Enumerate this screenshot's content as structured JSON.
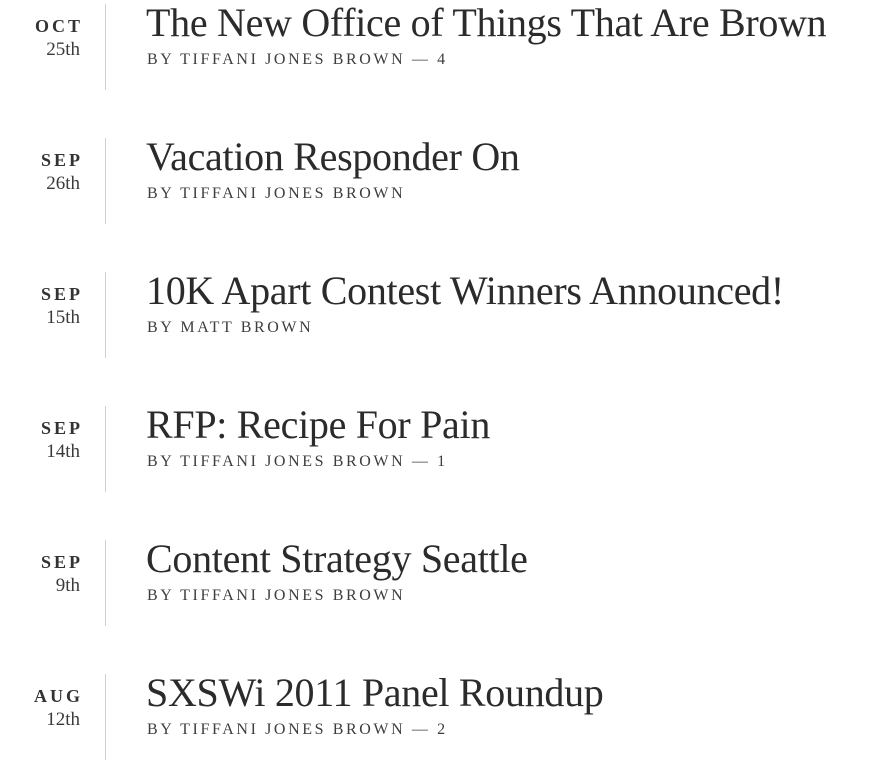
{
  "posts": [
    {
      "month": "OCT",
      "day": "25th",
      "title": "The New Office of Things That Are Brown",
      "byline": "BY TIFFANI JONES BROWN",
      "comments": "— 4"
    },
    {
      "month": "SEP",
      "day": "26th",
      "title": "Vacation Responder On",
      "byline": "BY TIFFANI JONES BROWN",
      "comments": ""
    },
    {
      "month": "SEP",
      "day": "15th",
      "title": "10K Apart Contest Winners Announced!",
      "byline": "BY MATT BROWN",
      "comments": ""
    },
    {
      "month": "SEP",
      "day": "14th",
      "title": "RFP: Recipe For Pain",
      "byline": "BY TIFFANI JONES BROWN",
      "comments": "— 1"
    },
    {
      "month": "SEP",
      "day": "9th",
      "title": "Content Strategy Seattle",
      "byline": "BY TIFFANI JONES BROWN",
      "comments": ""
    },
    {
      "month": "AUG",
      "day": "12th",
      "title": "SXSWi 2011 Panel Roundup",
      "byline": "BY TIFFANI JONES BROWN",
      "comments": "— 2"
    }
  ]
}
